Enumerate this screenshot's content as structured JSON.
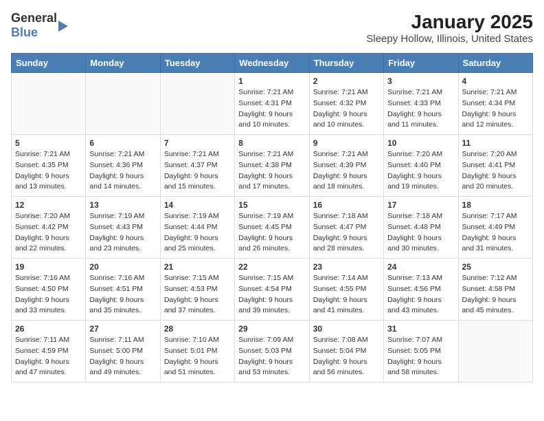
{
  "logo": {
    "line1": "General",
    "line2": "Blue"
  },
  "title": "January 2025",
  "subtitle": "Sleepy Hollow, Illinois, United States",
  "weekdays": [
    "Sunday",
    "Monday",
    "Tuesday",
    "Wednesday",
    "Thursday",
    "Friday",
    "Saturday"
  ],
  "weeks": [
    [
      {
        "day": "",
        "info": ""
      },
      {
        "day": "",
        "info": ""
      },
      {
        "day": "",
        "info": ""
      },
      {
        "day": "1",
        "info": "Sunrise: 7:21 AM\nSunset: 4:31 PM\nDaylight: 9 hours\nand 10 minutes."
      },
      {
        "day": "2",
        "info": "Sunrise: 7:21 AM\nSunset: 4:32 PM\nDaylight: 9 hours\nand 10 minutes."
      },
      {
        "day": "3",
        "info": "Sunrise: 7:21 AM\nSunset: 4:33 PM\nDaylight: 9 hours\nand 11 minutes."
      },
      {
        "day": "4",
        "info": "Sunrise: 7:21 AM\nSunset: 4:34 PM\nDaylight: 9 hours\nand 12 minutes."
      }
    ],
    [
      {
        "day": "5",
        "info": "Sunrise: 7:21 AM\nSunset: 4:35 PM\nDaylight: 9 hours\nand 13 minutes."
      },
      {
        "day": "6",
        "info": "Sunrise: 7:21 AM\nSunset: 4:36 PM\nDaylight: 9 hours\nand 14 minutes."
      },
      {
        "day": "7",
        "info": "Sunrise: 7:21 AM\nSunset: 4:37 PM\nDaylight: 9 hours\nand 15 minutes."
      },
      {
        "day": "8",
        "info": "Sunrise: 7:21 AM\nSunset: 4:38 PM\nDaylight: 9 hours\nand 17 minutes."
      },
      {
        "day": "9",
        "info": "Sunrise: 7:21 AM\nSunset: 4:39 PM\nDaylight: 9 hours\nand 18 minutes."
      },
      {
        "day": "10",
        "info": "Sunrise: 7:20 AM\nSunset: 4:40 PM\nDaylight: 9 hours\nand 19 minutes."
      },
      {
        "day": "11",
        "info": "Sunrise: 7:20 AM\nSunset: 4:41 PM\nDaylight: 9 hours\nand 20 minutes."
      }
    ],
    [
      {
        "day": "12",
        "info": "Sunrise: 7:20 AM\nSunset: 4:42 PM\nDaylight: 9 hours\nand 22 minutes."
      },
      {
        "day": "13",
        "info": "Sunrise: 7:19 AM\nSunset: 4:43 PM\nDaylight: 9 hours\nand 23 minutes."
      },
      {
        "day": "14",
        "info": "Sunrise: 7:19 AM\nSunset: 4:44 PM\nDaylight: 9 hours\nand 25 minutes."
      },
      {
        "day": "15",
        "info": "Sunrise: 7:19 AM\nSunset: 4:45 PM\nDaylight: 9 hours\nand 26 minutes."
      },
      {
        "day": "16",
        "info": "Sunrise: 7:18 AM\nSunset: 4:47 PM\nDaylight: 9 hours\nand 28 minutes."
      },
      {
        "day": "17",
        "info": "Sunrise: 7:18 AM\nSunset: 4:48 PM\nDaylight: 9 hours\nand 30 minutes."
      },
      {
        "day": "18",
        "info": "Sunrise: 7:17 AM\nSunset: 4:49 PM\nDaylight: 9 hours\nand 31 minutes."
      }
    ],
    [
      {
        "day": "19",
        "info": "Sunrise: 7:16 AM\nSunset: 4:50 PM\nDaylight: 9 hours\nand 33 minutes."
      },
      {
        "day": "20",
        "info": "Sunrise: 7:16 AM\nSunset: 4:51 PM\nDaylight: 9 hours\nand 35 minutes."
      },
      {
        "day": "21",
        "info": "Sunrise: 7:15 AM\nSunset: 4:53 PM\nDaylight: 9 hours\nand 37 minutes."
      },
      {
        "day": "22",
        "info": "Sunrise: 7:15 AM\nSunset: 4:54 PM\nDaylight: 9 hours\nand 39 minutes."
      },
      {
        "day": "23",
        "info": "Sunrise: 7:14 AM\nSunset: 4:55 PM\nDaylight: 9 hours\nand 41 minutes."
      },
      {
        "day": "24",
        "info": "Sunrise: 7:13 AM\nSunset: 4:56 PM\nDaylight: 9 hours\nand 43 minutes."
      },
      {
        "day": "25",
        "info": "Sunrise: 7:12 AM\nSunset: 4:58 PM\nDaylight: 9 hours\nand 45 minutes."
      }
    ],
    [
      {
        "day": "26",
        "info": "Sunrise: 7:11 AM\nSunset: 4:59 PM\nDaylight: 9 hours\nand 47 minutes."
      },
      {
        "day": "27",
        "info": "Sunrise: 7:11 AM\nSunset: 5:00 PM\nDaylight: 9 hours\nand 49 minutes."
      },
      {
        "day": "28",
        "info": "Sunrise: 7:10 AM\nSunset: 5:01 PM\nDaylight: 9 hours\nand 51 minutes."
      },
      {
        "day": "29",
        "info": "Sunrise: 7:09 AM\nSunset: 5:03 PM\nDaylight: 9 hours\nand 53 minutes."
      },
      {
        "day": "30",
        "info": "Sunrise: 7:08 AM\nSunset: 5:04 PM\nDaylight: 9 hours\nand 56 minutes."
      },
      {
        "day": "31",
        "info": "Sunrise: 7:07 AM\nSunset: 5:05 PM\nDaylight: 9 hours\nand 58 minutes."
      },
      {
        "day": "",
        "info": ""
      }
    ]
  ]
}
